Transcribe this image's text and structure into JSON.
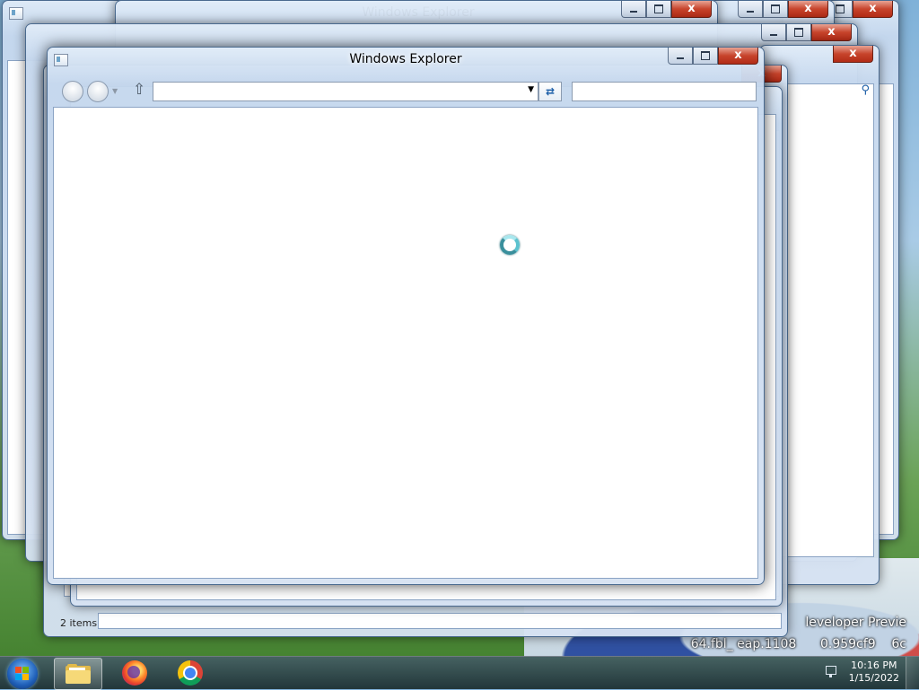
{
  "window": {
    "title": "Windows Explorer",
    "status_items": "2 items"
  },
  "desktop": {
    "watermark_line1": "leveloper Previe",
    "watermark_line2": "64.fbl_ eap.1108      0.959cf9    6c"
  },
  "buttons": {
    "close": "x"
  },
  "nav": {
    "up": "⇧",
    "dropdown": "▼",
    "refresh": "⇄"
  },
  "taskbar": {
    "pinned": [
      {
        "name": "Windows Explorer",
        "icon": "folder-icon",
        "active": true
      },
      {
        "name": "Firefox",
        "icon": "firefox-icon",
        "active": false
      },
      {
        "name": "Google Chrome",
        "icon": "chrome-icon",
        "active": false
      }
    ]
  },
  "clock": {
    "time": "10:16 PM",
    "date": "1/15/2022"
  },
  "colors": {
    "close_button": "#c7442c",
    "glass_frame": "#c6d8ee",
    "spinner": "#3a8f9c"
  }
}
